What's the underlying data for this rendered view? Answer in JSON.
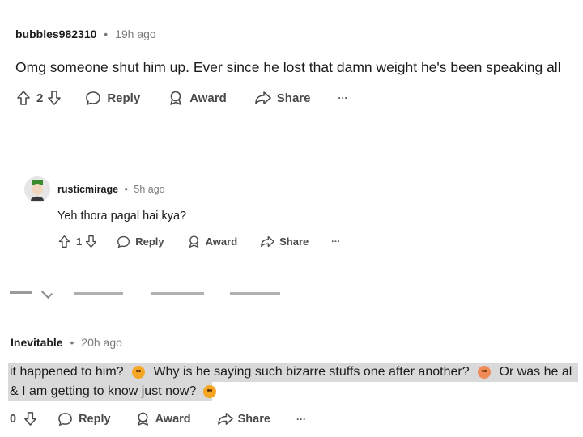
{
  "comment1": {
    "username": "bubbles982310",
    "sep": "•",
    "time": "19h ago",
    "text": "Omg someone shut him up. Ever since he lost that damn weight he's been speaking all",
    "votes": "2",
    "reply_label": "Reply",
    "award_label": "Award",
    "share_label": "Share",
    "more_label": "···"
  },
  "comment2": {
    "username": "rusticmirage",
    "sep": "•",
    "time": "5h ago",
    "text": "Yeh thora pagal hai kya?",
    "votes": "1",
    "reply_label": "Reply",
    "award_label": "Award",
    "share_label": "Share",
    "more_label": "···"
  },
  "comment3": {
    "username": "Inevitable",
    "sep": "•",
    "time": "20h ago",
    "line1_a": "it happened to him?",
    "line1_b": "Why is he saying such bizarre stuffs one after another?",
    "line1_c": "Or was he al",
    "line2": "& I am getting to know just now?",
    "votes": "0",
    "reply_label": "Reply",
    "award_label": "Award",
    "share_label": "Share",
    "more_label": "···"
  },
  "colors": {
    "text": "#1c1c1c",
    "meta": "#7c7c7c",
    "actions": "#4a4a4a",
    "highlight": "#d9d9d9"
  }
}
